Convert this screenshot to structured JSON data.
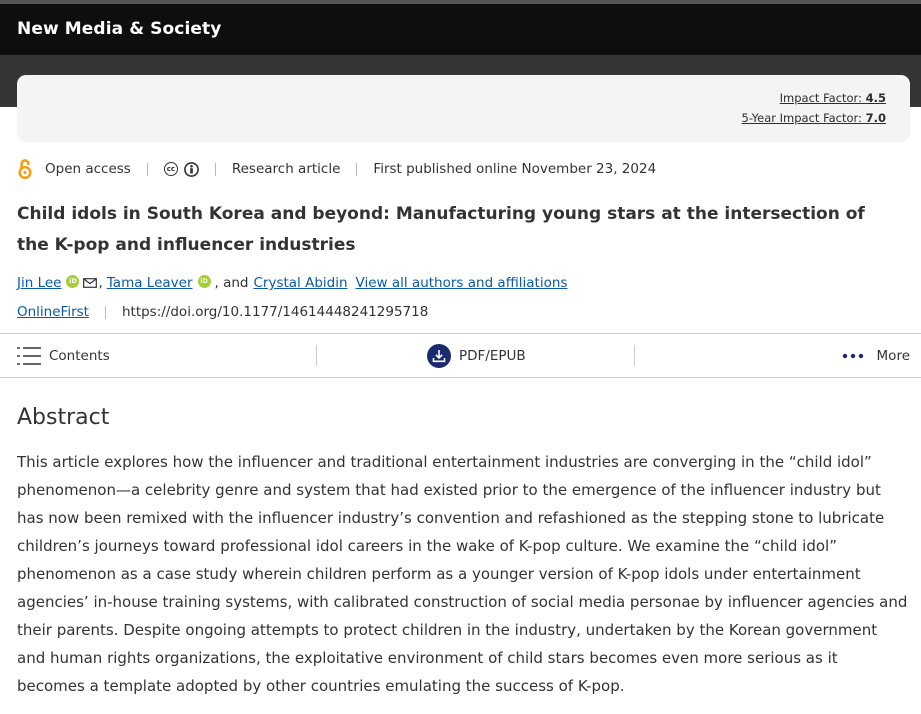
{
  "header": {
    "journal_title": "New Media & Society"
  },
  "metrics": {
    "impact_factor_label": "Impact Factor:",
    "impact_factor_value": "4.5",
    "five_year_label": "5-Year Impact Factor:",
    "five_year_value": "7.0"
  },
  "meta": {
    "access": "Open access",
    "license_icons": [
      "cc-icon",
      "by-icon"
    ],
    "article_type": "Research article",
    "published": "First published online November 23, 2024"
  },
  "article": {
    "title": "Child idols in South Korea and beyond: Manufacturing young stars at the intersection of the K-pop and influencer industries"
  },
  "authors": {
    "items": [
      {
        "name": "Jin Lee",
        "orcid": true,
        "email": true
      },
      {
        "name": "Tama Leaver",
        "orcid": true,
        "email": false
      },
      {
        "name": "Crystal Abidin",
        "orcid": false,
        "email": false
      }
    ],
    "sep1": ",",
    "sep2": ", and",
    "view_all": "View all authors and affiliations",
    "orcid_badge": "iD"
  },
  "issue": {
    "label": "OnlineFirst",
    "doi": "https://doi.org/10.1177/14614448241295718"
  },
  "toolbar": {
    "contents": "Contents",
    "pdf": "PDF/EPUB",
    "more": "More"
  },
  "abstract": {
    "heading": "Abstract",
    "text": "This article explores how the influencer and traditional entertainment industries are converging in the “child idol” phenomenon—a celebrity genre and system that had existed prior to the emergence of the influencer industry but has now been remixed with the influencer industry’s convention and refashioned as the stepping stone to lubricate children’s journeys toward professional idol careers in the wake of K-pop culture. We examine the “child idol” phenomenon as a case study wherein children perform as a younger version of K-pop idols under entertainment agencies’ in-house training systems, with calibrated construction of social media personae by influencer agencies and their parents. Despite ongoing attempts to protect children in the industry, undertaken by the Korean government and human rights organizations, the exploitative environment of child stars becomes even more serious as it becomes a template adopted by other countries emulating the success of K-pop."
  },
  "colors": {
    "link": "#0b59a8",
    "open_access": "#f29f19",
    "orcid": "#a6ce39",
    "pdf_icon": "#1a2a6e",
    "header": "#0e0e0e"
  }
}
